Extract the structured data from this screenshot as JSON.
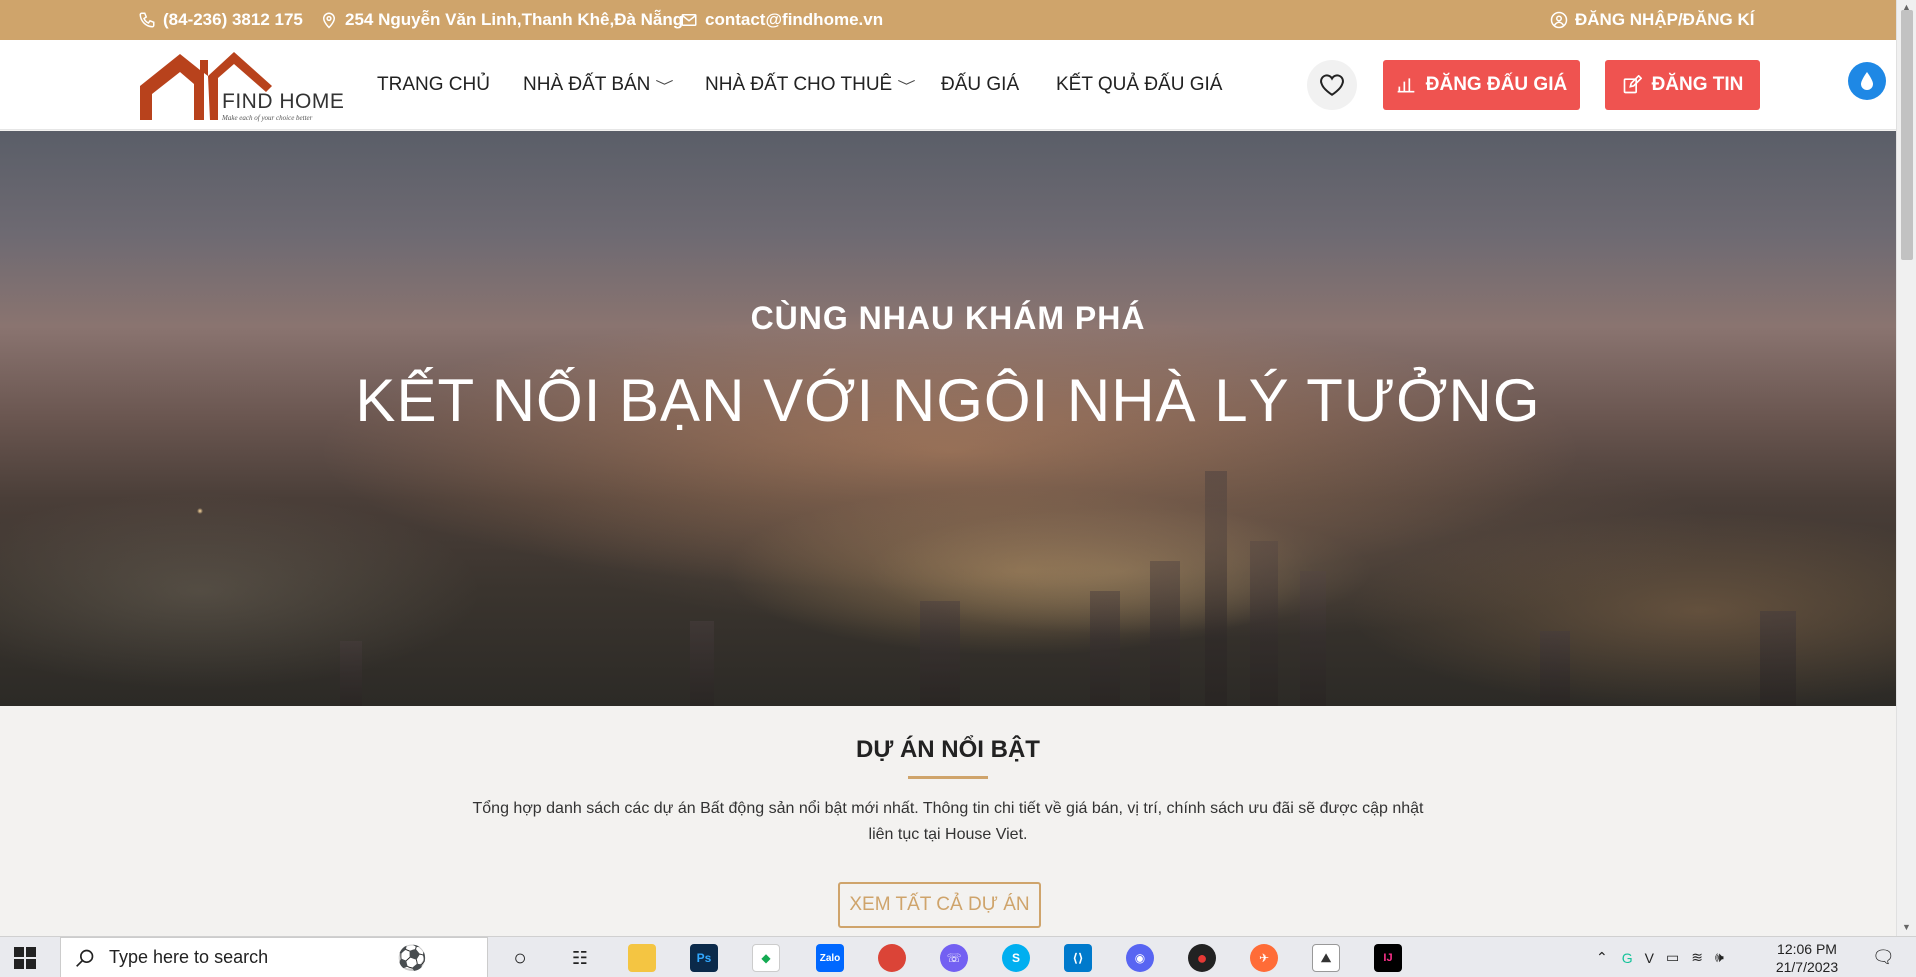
{
  "topbar": {
    "phone": "(84-236) 3812 175",
    "address": "254 Nguyễn Văn Linh,Thanh Khê,Đà Nẵng",
    "email": "contact@findhome.vn",
    "login": "ĐĂNG NHẬP/ĐĂNG KÍ"
  },
  "logo": {
    "name": "FIND HOME",
    "tagline": "Make each of your choice better"
  },
  "nav": {
    "home": "TRANG CHỦ",
    "sale": "NHÀ ĐẤT BÁN",
    "rent": "NHÀ ĐẤT CHO THUÊ",
    "auction": "ĐẤU GIÁ",
    "auction_results": "KẾT QUẢ ĐẤU GIÁ"
  },
  "actions": {
    "post_auction": "ĐĂNG ĐẤU GIÁ",
    "post_listing": "ĐĂNG TIN"
  },
  "hero": {
    "subtitle": "CÙNG NHAU KHÁM PHÁ",
    "title": "KẾT NỐI BẠN VỚI NGÔI NHÀ LÝ TƯỞNG"
  },
  "featured": {
    "title": "DỰ ÁN NỔI BẬT",
    "description": "Tổng hợp danh sách các dự án Bất động sản nổi bật mới nhất. Thông tin chi tiết về giá bán, vị trí, chính sách ưu đãi sẽ được cập nhật liên tục tại House Viet.",
    "button": "XEM TẤT CẢ DỰ ÁN"
  },
  "taskbar": {
    "search_placeholder": "Type here to search",
    "time": "12:06 PM",
    "date": "21/7/2023"
  },
  "colors": {
    "topbar": "#cfa46b",
    "accent_red": "#ef5350",
    "gold": "#cfa46b"
  }
}
